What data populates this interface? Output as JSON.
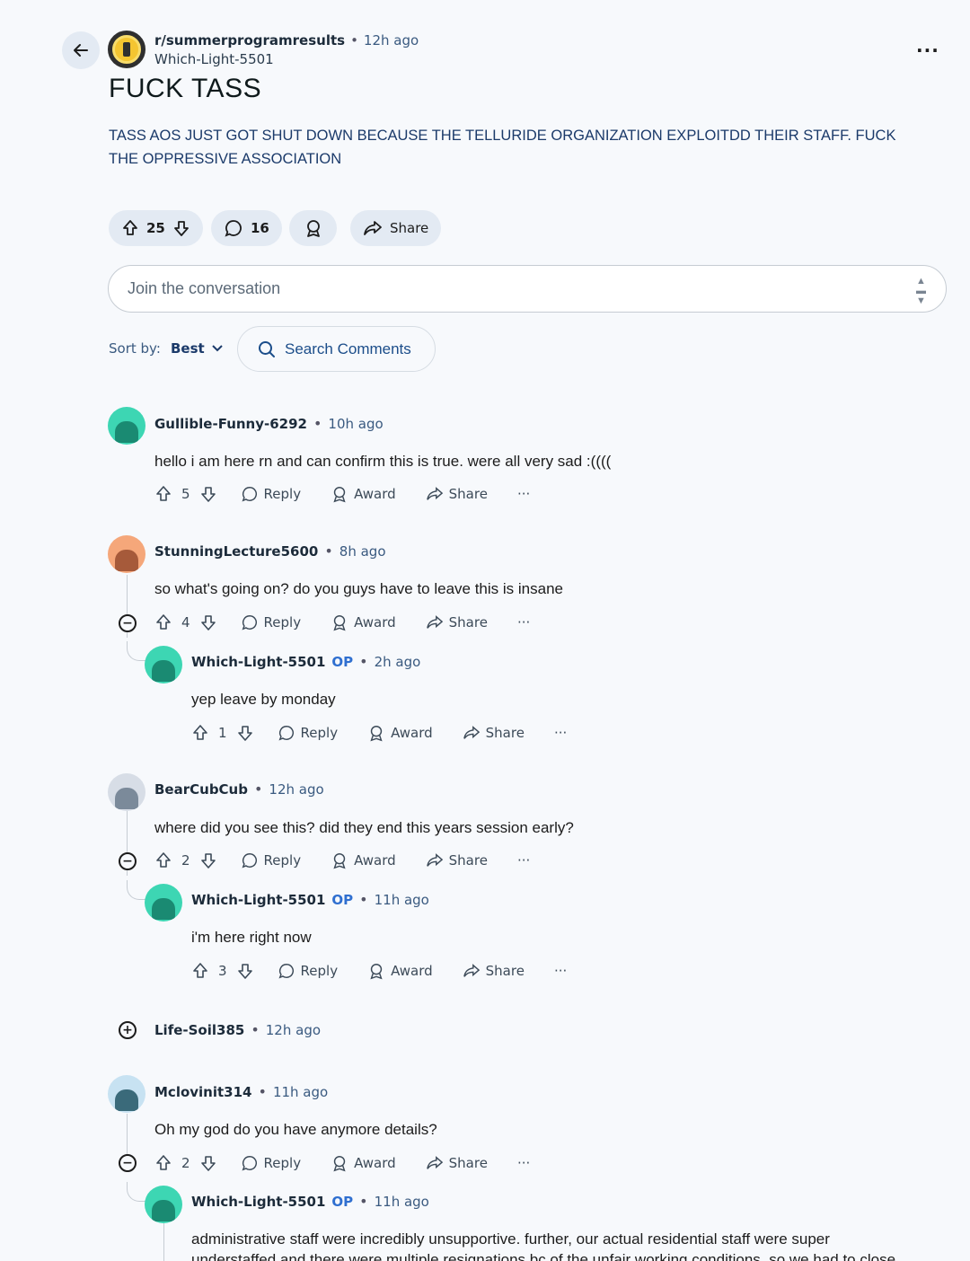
{
  "post": {
    "subreddit": "r/summerprogramresults",
    "time": "12h ago",
    "author": "Which-Light-5501",
    "title": "FUCK TASS",
    "body": "TASS AOS JUST GOT SHUT DOWN BECAUSE THE TELLURIDE ORGANIZATION EXPLOITDD THEIR STAFF. FUCK THE OPPRESSIVE ASSOCIATION",
    "votes": "25",
    "comments": "16",
    "share_label": "Share"
  },
  "composer": {
    "placeholder": "Join the conversation"
  },
  "sort": {
    "label": "Sort by:",
    "value": "Best"
  },
  "search": {
    "label": "Search Comments"
  },
  "action_labels": {
    "reply": "Reply",
    "award": "Award",
    "share": "Share",
    "op": "OP"
  },
  "comments": [
    {
      "author": "Gullible-Funny-6292",
      "time": "10h ago",
      "text": "hello i am here rn and can confirm this is true. were all very sad :((((",
      "votes": "5"
    },
    {
      "author": "StunningLecture5600",
      "time": "8h ago",
      "text": "so what's going on? do you guys have to leave this is insane",
      "votes": "4"
    },
    {
      "author": "Which-Light-5501",
      "time": "2h ago",
      "text": "yep leave by monday",
      "votes": "1"
    },
    {
      "author": "BearCubCub",
      "time": "12h ago",
      "text": "where did you see this? did they end this years session early?",
      "votes": "2"
    },
    {
      "author": "Which-Light-5501",
      "time": "11h ago",
      "text": "i'm here right now",
      "votes": "3"
    },
    {
      "author": "Life-Soil385",
      "time": "12h ago"
    },
    {
      "author": "Mclovinit314",
      "time": "11h ago",
      "text": "Oh my god do you have anymore details?",
      "votes": "2"
    },
    {
      "author": "Which-Light-5501",
      "time": "11h ago",
      "text": "administrative staff were incredibly unsupportive. further, our actual residential staff were super",
      "text2": "understaffed and there were multiple resignations bc of the unfair working conditions, so we had to close"
    }
  ]
}
